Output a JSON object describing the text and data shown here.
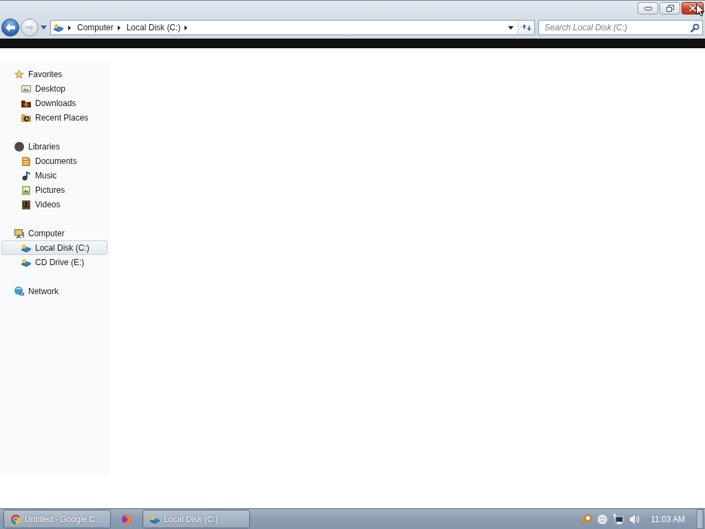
{
  "address_bar": {
    "breadcrumbs": [
      "Computer",
      "Local Disk (C:)"
    ]
  },
  "search": {
    "placeholder": "Search Local Disk (C:)"
  },
  "sidebar": {
    "groups": [
      {
        "label": "Favorites",
        "kind": "favorites",
        "selected": false,
        "children": [
          {
            "label": "Desktop",
            "kind": "desktop",
            "selected": false
          },
          {
            "label": "Downloads",
            "kind": "downloads",
            "selected": false
          },
          {
            "label": "Recent Places",
            "kind": "recent",
            "selected": false
          }
        ]
      },
      {
        "label": "Libraries",
        "kind": "libraries",
        "selected": false,
        "children": [
          {
            "label": "Documents",
            "kind": "documents",
            "selected": false
          },
          {
            "label": "Music",
            "kind": "music",
            "selected": false
          },
          {
            "label": "Pictures",
            "kind": "pictures",
            "selected": false
          },
          {
            "label": "Videos",
            "kind": "videos",
            "selected": false
          }
        ]
      },
      {
        "label": "Computer",
        "kind": "computer",
        "selected": false,
        "children": [
          {
            "label": "Local Disk (C:)",
            "kind": "drive",
            "selected": true
          },
          {
            "label": "CD Drive (E:)",
            "kind": "drive",
            "selected": false
          }
        ]
      },
      {
        "label": "Network",
        "kind": "network",
        "selected": false
      }
    ]
  },
  "taskbar": {
    "buttons": [
      {
        "label": "Untitled - Google C...",
        "kind": "chrome"
      },
      {
        "kind": "firefox"
      },
      {
        "label": "Local Disk (C:)",
        "kind": "explorer"
      }
    ],
    "clock": "11:03 AM"
  }
}
